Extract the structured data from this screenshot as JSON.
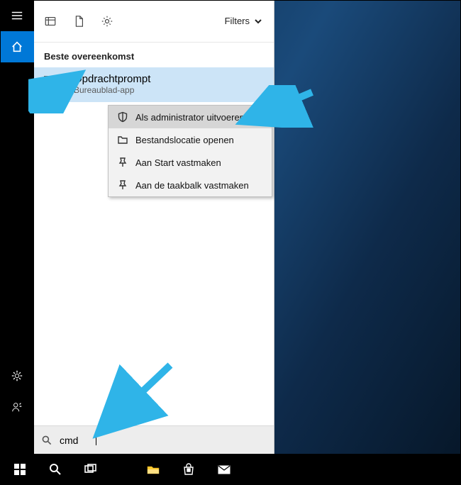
{
  "panel": {
    "filters_label": "Filters",
    "section_label": "Beste overeenkomst",
    "best_match": {
      "title": "Opdrachtprompt",
      "subtitle": "Bureaublad-app"
    }
  },
  "context_menu": {
    "items": [
      "Als administrator uitvoeren",
      "Bestandslocatie openen",
      "Aan Start vastmaken",
      "Aan de taakbalk vastmaken"
    ]
  },
  "search": {
    "value": "cmd",
    "placeholder": ""
  },
  "colors": {
    "accent": "#0078d7",
    "arrow": "#2fb4e8"
  }
}
